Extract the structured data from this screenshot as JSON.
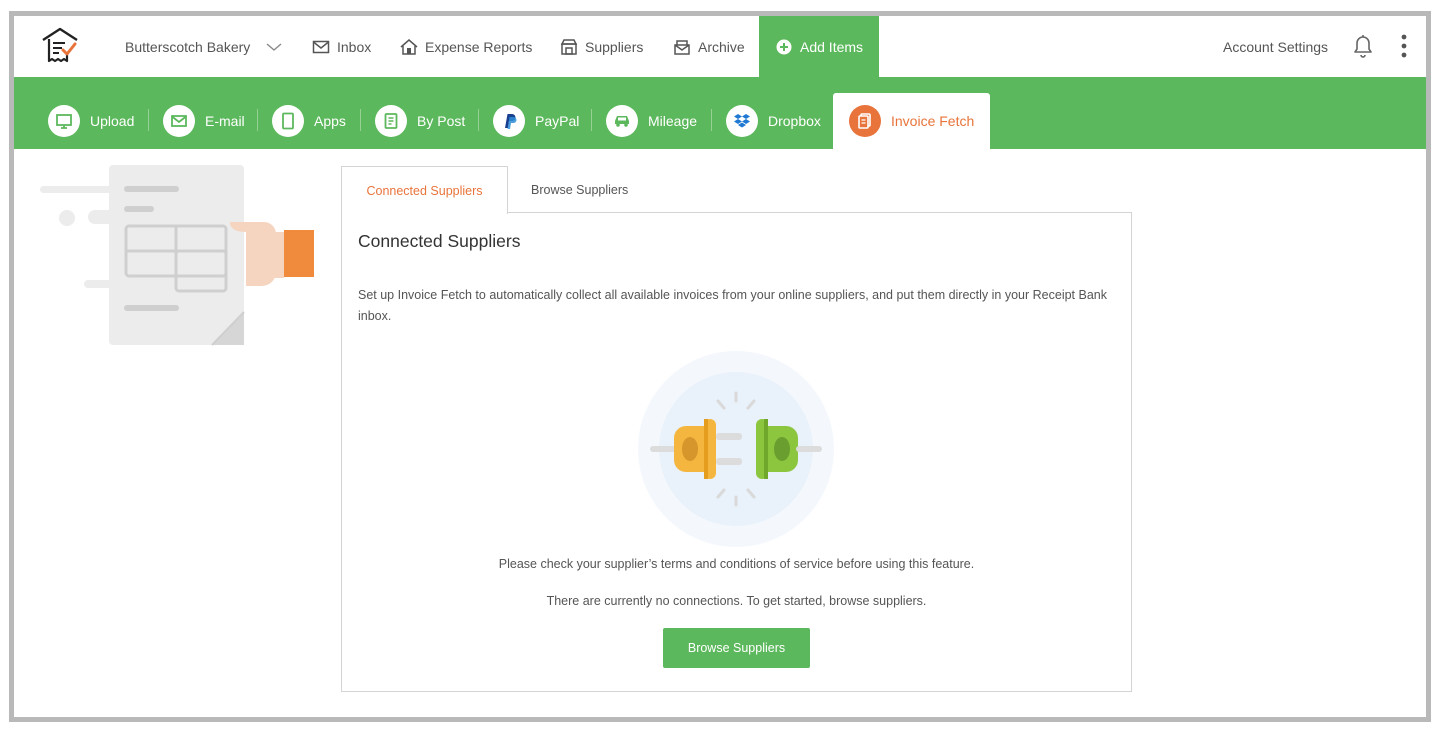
{
  "header": {
    "company": "Butterscotch Bakery",
    "nav": [
      {
        "label": "Inbox",
        "icon": "envelope-icon"
      },
      {
        "label": "Expense Reports",
        "icon": "expense-reports-icon"
      },
      {
        "label": "Suppliers",
        "icon": "suppliers-icon"
      },
      {
        "label": "Archive",
        "icon": "archive-icon"
      },
      {
        "label": "Add Items",
        "icon": "plus-circle-icon"
      }
    ],
    "account_settings": "Account Settings"
  },
  "sources": [
    {
      "label": "Upload",
      "icon": "monitor-icon"
    },
    {
      "label": "E-mail",
      "icon": "envelope-icon"
    },
    {
      "label": "Apps",
      "icon": "tablet-icon"
    },
    {
      "label": "By Post",
      "icon": "document-icon"
    },
    {
      "label": "PayPal",
      "icon": "paypal-icon"
    },
    {
      "label": "Mileage",
      "icon": "car-icon"
    },
    {
      "label": "Dropbox",
      "icon": "dropbox-icon"
    },
    {
      "label": "Invoice Fetch",
      "icon": "invoice-fetch-icon",
      "active": true
    }
  ],
  "panel": {
    "tabs": [
      {
        "label": "Connected Suppliers",
        "active": true
      },
      {
        "label": "Browse Suppliers",
        "active": false
      }
    ],
    "title": "Connected Suppliers",
    "description": "Set up Invoice Fetch to automatically collect all available invoices from your online suppliers, and put them directly in your Receipt Bank inbox.",
    "terms": "Please check your supplier’s terms and conditions of service before using this feature.",
    "no_connections": "There are currently no connections. To get started, browse suppliers.",
    "button": "Browse Suppliers"
  },
  "colors": {
    "brand_green": "#5cb85c",
    "accent_orange": "#e8743b",
    "plug_yellow": "#f4b63f",
    "plug_green": "#8cc63f"
  }
}
